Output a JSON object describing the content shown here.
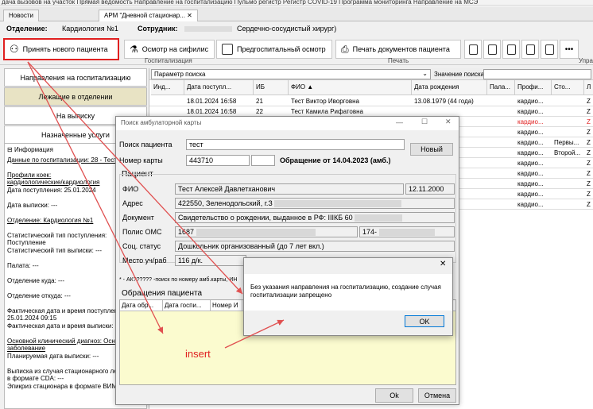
{
  "top_strip": "дача вызовов на участок    Прямая ведомость    Направление на госпитализацию    Пульмо регистр    Регистр COVID-19    Программа мониторинга    Направление на МСЭ",
  "tabs": [
    {
      "label": "Новости"
    },
    {
      "label": "АРМ \"Дневной стационар..."
    }
  ],
  "header": {
    "dept_label": "Отделение:",
    "dept_value": "Кардиология №1",
    "employee_label": "Сотрудник:",
    "employee_value": "Сердечно-сосудистый хирург)"
  },
  "toolbar": {
    "accept_patient": "Принять нового пациента",
    "syphilis": "Осмотр на сифилис",
    "pre_hosp": "Предгоспитальный осмотр",
    "print_docs": "Печать документов пациента",
    "group_hosp": "Госпитализация",
    "group_print": "Печать",
    "group_manage": "Упра"
  },
  "nav": {
    "to_hosp": "Направления на госпитализацию",
    "in_dept": "Лежащие в отделении",
    "to_discharge": "На выписку",
    "services": "Назначенные услуги"
  },
  "info": {
    "title": "Информация",
    "lines": [
      {
        "text": "Данные по госпитализации: 28 - Тест",
        "u": true
      },
      {
        "text": "",
        "u": false
      },
      {
        "text": "Профили коек:",
        "u": true
      },
      {
        "text": "кардиологические/кардиология",
        "u": true
      },
      {
        "text": "Дата поступления: 25.01.2024",
        "u": false
      },
      {
        "text": "",
        "u": false
      },
      {
        "text": "Дата выписки: ---",
        "u": false
      },
      {
        "text": "",
        "u": false
      },
      {
        "text": "Отделение: Кардиология №1",
        "u": true
      },
      {
        "text": "",
        "u": false
      },
      {
        "text": "Статистический тип поступления:",
        "u": false
      },
      {
        "text": "Поступление",
        "u": false
      },
      {
        "text": "Статистический тип выписки: ---",
        "u": false
      },
      {
        "text": "",
        "u": false
      },
      {
        "text": "Палата: ---",
        "u": false
      },
      {
        "text": "",
        "u": false
      },
      {
        "text": "Отделение куда: ---",
        "u": false
      },
      {
        "text": "",
        "u": false
      },
      {
        "text": "Отделение откуда: ---",
        "u": false
      },
      {
        "text": "",
        "u": false
      },
      {
        "text": "Фактическая дата и время поступлен",
        "u": false
      },
      {
        "text": "25.01.2024 09:15",
        "u": false
      },
      {
        "text": "Фактическая дата и время выписки: -",
        "u": false
      },
      {
        "text": "",
        "u": false
      },
      {
        "text": "Основной клинический диагноз: Осн",
        "u": true
      },
      {
        "text": "заболевание",
        "u": true
      },
      {
        "text": "Планируемая дата выписки: ---",
        "u": false
      },
      {
        "text": "",
        "u": false
      },
      {
        "text": "Выписка из случая стационарного ле",
        "u": false
      },
      {
        "text": "в формате CDA: ---",
        "u": false
      },
      {
        "text": "Эпикриз стационара в формате ВИМ",
        "u": false
      }
    ]
  },
  "grid": {
    "param_label": "Параметр поиска",
    "value_label": "Значение поиска",
    "headers": [
      "Инд...",
      "Дата поступл...",
      "ИБ",
      "ФИО ▲",
      "Дата рождения",
      "Пала...",
      "Профи...",
      "Сто...",
      "Л"
    ],
    "rows": [
      {
        "cells": [
          "",
          "18.01.2024 16:58",
          "21",
          "Тест Виктор Иворговна",
          "13.08.1979 (44 года)",
          "",
          "кардио...",
          "",
          "Z"
        ],
        "red": false
      },
      {
        "cells": [
          "",
          "18.01.2024 16:58",
          "22",
          "Тест Камила Рифатовна",
          "",
          "",
          "кардио...",
          "",
          "Z"
        ],
        "red": false
      },
      {
        "cells": [
          "",
          "",
          "",
          "",
          "лет)",
          "",
          "кардио...",
          "",
          "Z"
        ],
        "red": true
      },
      {
        "cells": [
          "",
          "",
          "",
          "",
          "",
          "",
          "кардио...",
          "",
          "Z"
        ],
        "red": false
      },
      {
        "cells": [
          "",
          "",
          "",
          "",
          "лет)",
          "",
          "кардио...",
          "Первы...",
          "Z"
        ],
        "red": false
      },
      {
        "cells": [
          "",
          "",
          "",
          "",
          "лет)",
          "",
          "кардио...",
          "Второй...",
          "Z"
        ],
        "red": false
      },
      {
        "cells": [
          "",
          "",
          "",
          "",
          "",
          "",
          "кардио...",
          "",
          "Z"
        ],
        "red": false
      },
      {
        "cells": [
          "",
          "",
          "",
          "",
          "",
          "",
          "кардио...",
          "",
          "Z"
        ],
        "red": false
      },
      {
        "cells": [
          "",
          "",
          "",
          "",
          "",
          "",
          "кардио...",
          "",
          "Z"
        ],
        "red": false
      },
      {
        "cells": [
          "",
          "",
          "",
          "",
          "",
          "",
          "кардио...",
          "",
          "Z"
        ],
        "red": false
      },
      {
        "cells": [
          "",
          "",
          "",
          "",
          "",
          "",
          "кардио...",
          "",
          "Z"
        ],
        "red": false
      }
    ]
  },
  "dialog": {
    "title": "Поиск амбулаторной карты",
    "search_label": "Поиск пациента",
    "search_value": "тест",
    "card_label": "Номер карты",
    "card_value": "443710",
    "visit_text": "Обращение от 14.04.2023 (амб.)",
    "new_btn": "Новый",
    "patient_section": "Пациент",
    "fio_label": "ФИО",
    "fio_value": "Тест Алексей Давлетханович",
    "birth_value": "12.11.2000",
    "address_label": "Адрес",
    "address_value": "422550, Зеленодольский, г.З",
    "doc_label": "Документ",
    "doc_value": "Свидетельство о рождении, выданное в РФ: IIIКБ 60",
    "oms_label": "Полис ОМС",
    "oms_value": "1687",
    "oms_value2": "174-",
    "social_label": "Соц. статус",
    "social_value": "Дошкольник организованный (до 7 лет вкл.)",
    "place_label": "Место уч/раб",
    "place_value": "116 д/к.",
    "hint": "* - АК?????? -поиск по номеру амб.карты, ИН",
    "appeals_section": "Обращения пациента",
    "appeals_headers": [
      "Дата обр...",
      "Дата госпи...",
      "Номер И"
    ],
    "ok_btn": "Ok",
    "cancel_btn": "Отмена"
  },
  "message": {
    "text": "Без указания направления на госпитализацию, создание случая госпитализации запрещено",
    "ok": "OK"
  },
  "annotation": "insert",
  "colors": {
    "highlight_red": "#e02020",
    "arrow_red": "#e05050",
    "selected_nav": "#e8e3c4",
    "appeals_yellow": "#fbfbcf"
  }
}
